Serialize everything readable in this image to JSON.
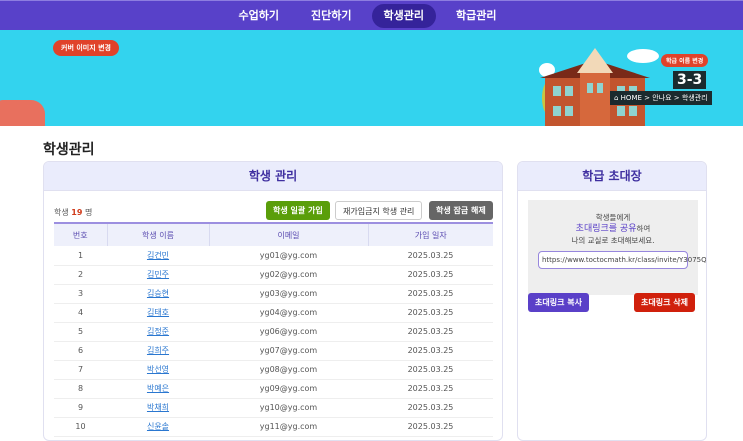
{
  "nav": [
    "수업하기",
    "진단하기",
    "학생관리",
    "학급관리"
  ],
  "banner": {
    "cover_button": "커버 이미지 변경",
    "class_name_button": "학급 이름 변경",
    "class_name": "3-3",
    "breadcrumb": "HOME > 안나요 > 학생관리"
  },
  "page_title": "학생관리",
  "students": {
    "header": "학생 관리",
    "count_prefix": "학생",
    "count": "19",
    "count_suffix": "명",
    "buttons": {
      "bulk": "학생 일괄 가입",
      "banned": "재가입금지 학생 관리",
      "unlock": "학생 잠금 해제"
    },
    "columns": [
      "번호",
      "학생 이름",
      "이메일",
      "가입 일자"
    ],
    "rows": [
      [
        "1",
        "김건민",
        "yg01@yg.com",
        "2025.03.25"
      ],
      [
        "2",
        "김민주",
        "yg02@yg.com",
        "2025.03.25"
      ],
      [
        "3",
        "김승현",
        "yg03@yg.com",
        "2025.03.25"
      ],
      [
        "4",
        "김태호",
        "yg04@yg.com",
        "2025.03.25"
      ],
      [
        "5",
        "김정준",
        "yg06@yg.com",
        "2025.03.25"
      ],
      [
        "6",
        "김희주",
        "yg07@yg.com",
        "2025.03.25"
      ],
      [
        "7",
        "박선영",
        "yg08@yg.com",
        "2025.03.25"
      ],
      [
        "8",
        "박예은",
        "yg09@yg.com",
        "2025.03.25"
      ],
      [
        "9",
        "박채희",
        "yg10@yg.com",
        "2025.03.25"
      ],
      [
        "10",
        "신윤솔",
        "yg11@yg.com",
        "2025.03.25"
      ]
    ]
  },
  "invite": {
    "header": "학급 초대장",
    "line1": "학생들에게",
    "highlight": "초대링크를 공유",
    "line2_suffix": "하여",
    "line3": "나의 교실로 초대해보세요.",
    "url": "https://www.toctocmath.kr/class/invite/Y3075Q",
    "copy": "초대링크 복사",
    "delete": "초대링크 삭제"
  }
}
